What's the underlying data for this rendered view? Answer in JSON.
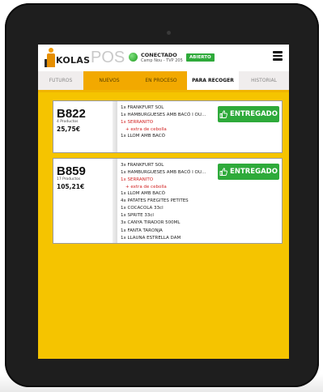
{
  "brand": {
    "logo_text": "KOLAS",
    "pos_text": "POS"
  },
  "connection": {
    "status": "CONECTADO",
    "subtitle": "Camp Nou - TVP 205",
    "badge": "ABIERTO"
  },
  "colors": {
    "accent": "#f5c400",
    "tab_active": "#ffffff",
    "success": "#2eaa3a",
    "alert": "#d22424"
  },
  "icons": {
    "menu": "hamburger-menu-icon",
    "thumb": "thumbs-up-icon",
    "warning": "warning-triangle-icon",
    "status": "status-dot-icon"
  },
  "tabs": [
    {
      "label": "FUTUROS"
    },
    {
      "label": "NUEVOS"
    },
    {
      "label": "EN PROCESO"
    },
    {
      "label": "PARA RECOGER"
    },
    {
      "label": "HISTORIAL"
    }
  ],
  "active_tab": "PARA RECOGER",
  "orders": [
    {
      "code": "B822",
      "count": "4 Productos",
      "total": "25,75€",
      "action": "ENTREGADO",
      "items": [
        {
          "text": "1x FRANKFURT SOL"
        },
        {
          "text": "1x HAMBURGUESES AMB BACÓ I OU..."
        },
        {
          "text": "1x SERRANITO",
          "alert": true,
          "modifier": "+ extra de cebolla"
        },
        {
          "text": "1x LLOM AMB BACÓ"
        }
      ]
    },
    {
      "code": "B859",
      "count": "17 Productos",
      "total": "105,21€",
      "action": "ENTREGADO",
      "items": [
        {
          "text": "3x FRANKFURT SOL"
        },
        {
          "text": "1x HAMBURGUESES AMB BACÓ I OU..."
        },
        {
          "text": "1x SERRANITO",
          "alert": true,
          "modifier": "+ extra de cebolla"
        },
        {
          "text": "1x LLOM AMB BACÓ"
        },
        {
          "text": "4x PATATES FREGITES PETITES"
        },
        {
          "text": "1x COCACOLA 33cl"
        },
        {
          "text": "1x SPRITE 33cl"
        },
        {
          "text": "3x CANYA TIRADOR 500ML"
        },
        {
          "text": "1x FANTA TARONJA"
        },
        {
          "text": "1x LLAUNA ESTRELLA DAM"
        }
      ]
    }
  ]
}
